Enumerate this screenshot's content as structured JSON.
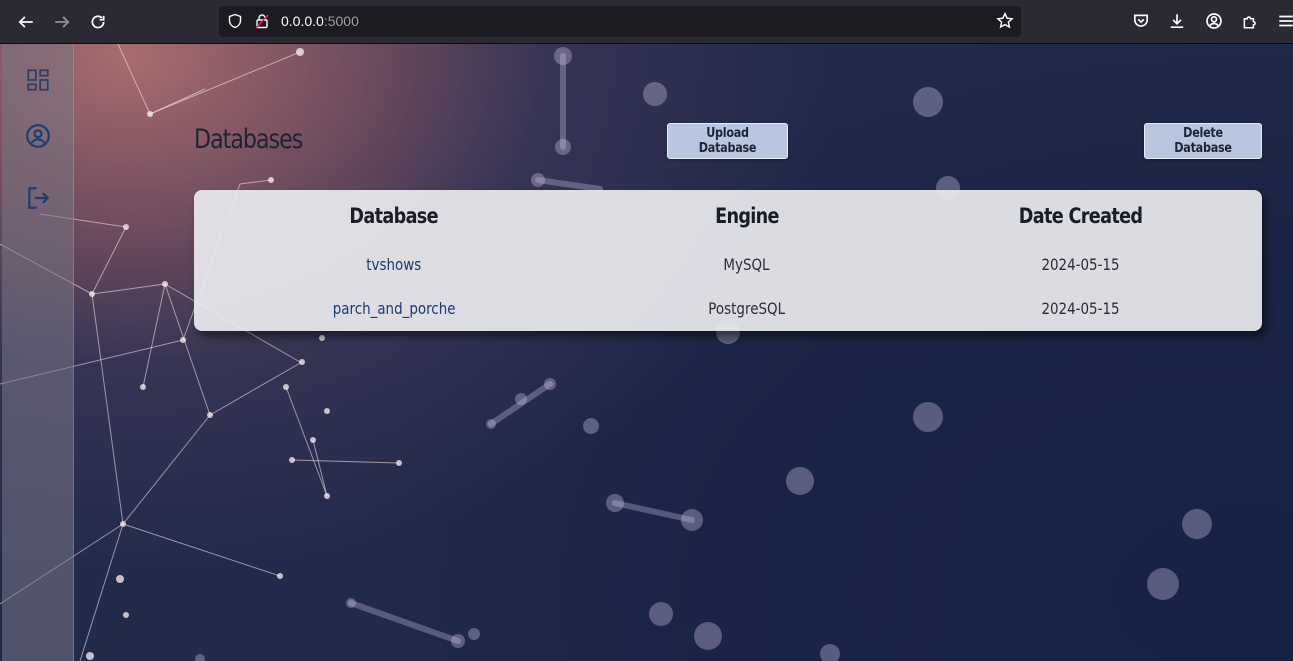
{
  "browser": {
    "url_host": "0.0.0.0",
    "url_port": ":5000"
  },
  "page": {
    "title": "Databases",
    "upload_label": "Upload Database",
    "delete_label": "Delete Database"
  },
  "table": {
    "headers": [
      "Database",
      "Engine",
      "Date Created"
    ],
    "rows": [
      {
        "database": "tvshows",
        "engine": "MySQL",
        "date": "2024-05-15"
      },
      {
        "database": "parch_and_porche",
        "engine": "PostgreSQL",
        "date": "2024-05-15"
      }
    ]
  },
  "sidebar": {
    "items": [
      {
        "icon": "dashboard-icon"
      },
      {
        "icon": "account-icon"
      },
      {
        "icon": "logout-icon"
      }
    ]
  },
  "colors": {
    "sidebar_icon": "#1f3c6e",
    "button_bg": "#b8c7de",
    "card_bg": "#ececf0",
    "link": "#1d3a6b"
  }
}
